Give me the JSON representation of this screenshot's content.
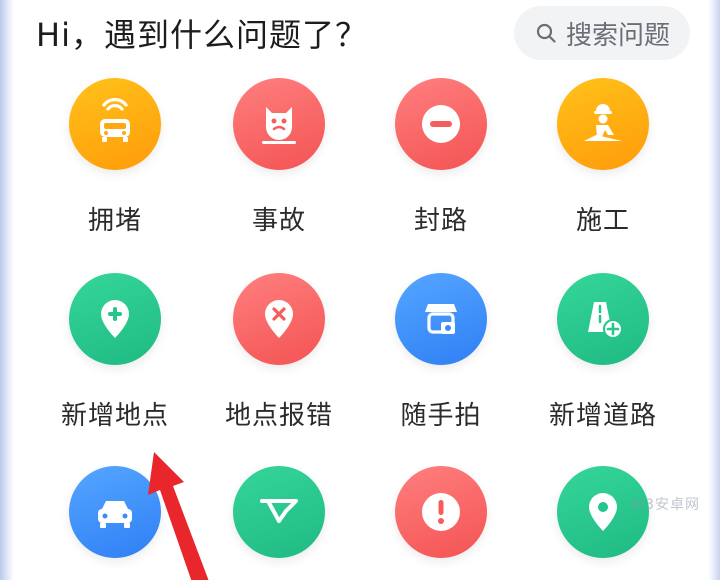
{
  "header": {
    "title": "Hi，遇到什么问题了？",
    "search_label": "搜索问题"
  },
  "grid": {
    "row1": [
      {
        "label": "拥堵",
        "icon": "traffic-jam-icon",
        "color": "#ffa812"
      },
      {
        "label": "事故",
        "icon": "accident-icon",
        "color": "#f65c5c"
      },
      {
        "label": "封路",
        "icon": "road-closed-icon",
        "color": "#f65c5c"
      },
      {
        "label": "施工",
        "icon": "construction-icon",
        "color": "#ffa812"
      }
    ],
    "row2": [
      {
        "label": "新增地点",
        "icon": "add-place-icon",
        "color": "#25c58b"
      },
      {
        "label": "地点报错",
        "icon": "place-error-icon",
        "color": "#f65c5c"
      },
      {
        "label": "随手拍",
        "icon": "snapshot-icon",
        "color": "#3b8cf8"
      },
      {
        "label": "新增道路",
        "icon": "add-road-icon",
        "color": "#25c58b"
      }
    ],
    "row3": [
      {
        "icon": "car-icon",
        "color": "#3b8cf8"
      },
      {
        "icon": "route-icon",
        "color": "#25c58b"
      },
      {
        "icon": "alert-icon",
        "color": "#f65c5c"
      },
      {
        "icon": "location-pin-icon",
        "color": "#25c58b"
      }
    ]
  },
  "watermark": "9i3安卓网"
}
